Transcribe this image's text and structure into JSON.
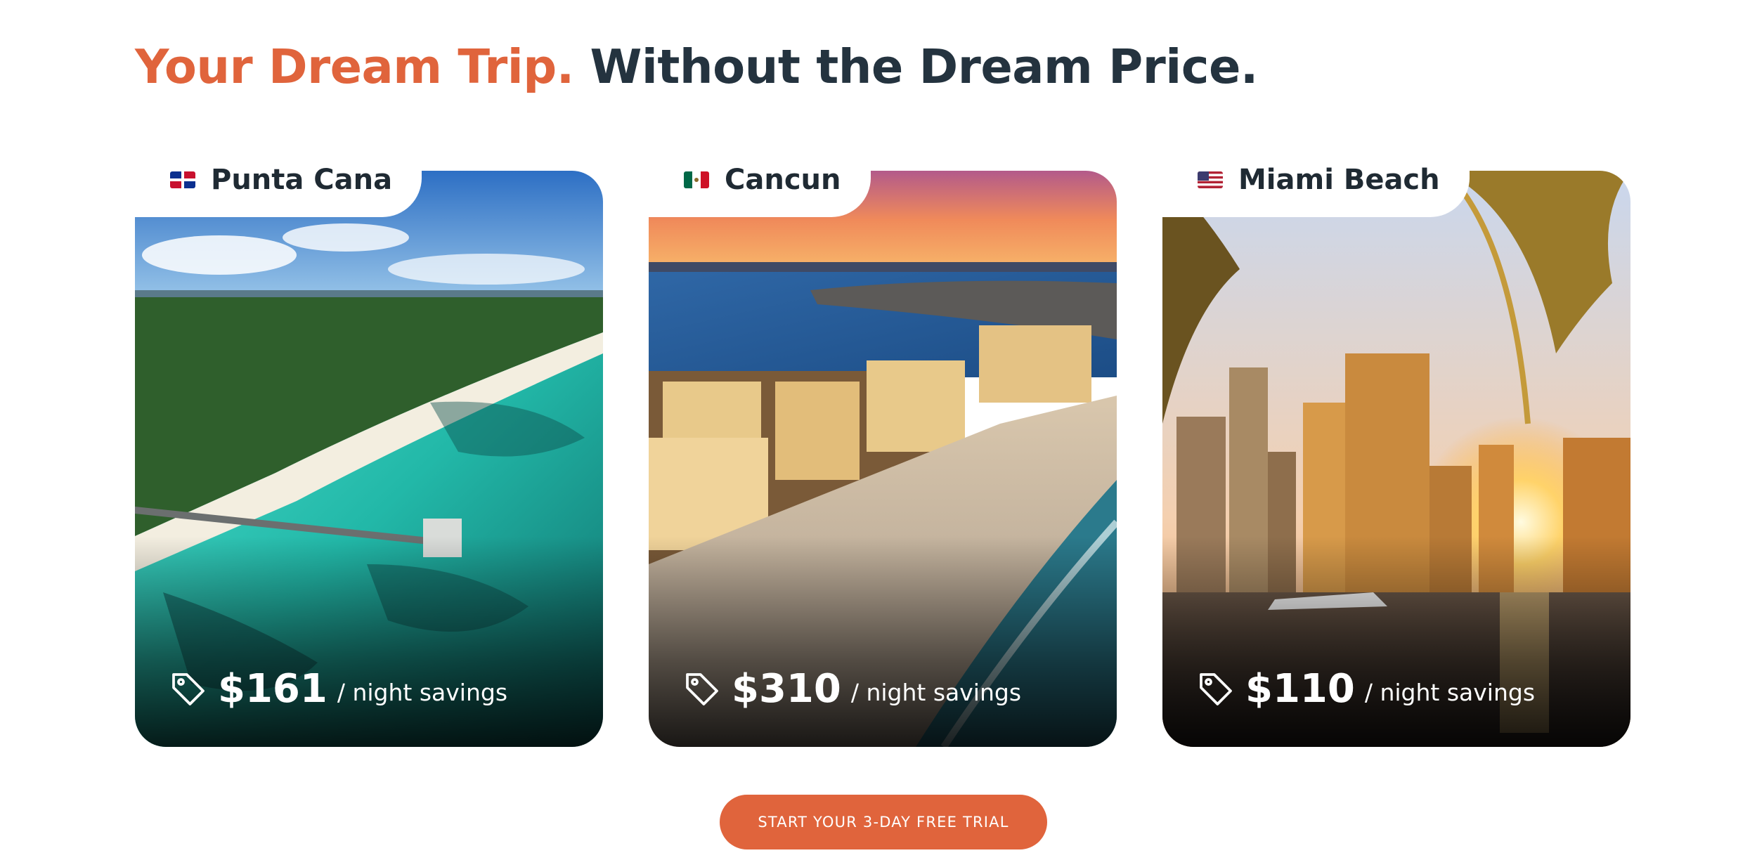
{
  "headline": {
    "accent": "Your Dream Trip.",
    "rest": "Without the Dream Price."
  },
  "colors": {
    "accent": "#e0643c",
    "dark": "#24333f"
  },
  "destinations": [
    {
      "name": "Punta Cana",
      "flag": "dominican-republic-flag",
      "amount": "$161",
      "unit": "/ night savings",
      "icon": "price-tag-icon"
    },
    {
      "name": "Cancun",
      "flag": "mexico-flag",
      "amount": "$310",
      "unit": "/ night savings",
      "icon": "price-tag-icon"
    },
    {
      "name": "Miami Beach",
      "flag": "usa-flag",
      "amount": "$110",
      "unit": "/ night savings",
      "icon": "price-tag-icon"
    }
  ],
  "cta": {
    "label": "START YOUR 3-DAY FREE TRIAL"
  }
}
